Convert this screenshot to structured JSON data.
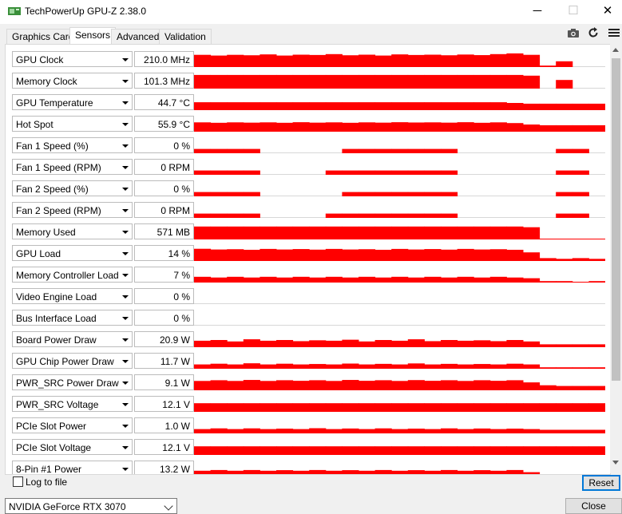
{
  "window": {
    "title": "TechPowerUp GPU-Z 2.38.0"
  },
  "tabs": [
    "Graphics Card",
    "Sensors",
    "Advanced",
    "Validation"
  ],
  "sensors": [
    {
      "name": "GPU Clock",
      "value": "210.0 MHz",
      "trace": [
        0.85,
        0.8,
        0.85,
        0.82,
        0.88,
        0.8,
        0.86,
        0.84,
        0.9,
        0.82,
        0.86,
        0.8,
        0.88,
        0.84,
        0.86,
        0.82,
        0.87,
        0.83,
        0.9,
        0.95,
        0.85,
        0.1,
        0.4,
        0.0,
        0.0
      ],
      "color": "#ff0000"
    },
    {
      "name": "Memory Clock",
      "value": "101.3 MHz",
      "trace": [
        0.95,
        0.95,
        0.95,
        0.95,
        0.95,
        0.95,
        0.95,
        0.95,
        0.95,
        0.95,
        0.95,
        0.95,
        0.95,
        0.95,
        0.95,
        0.95,
        0.95,
        0.95,
        0.95,
        0.95,
        0.9,
        0.0,
        0.6,
        0.0,
        0.0
      ],
      "color": "#ff0000"
    },
    {
      "name": "GPU Temperature",
      "value": "44.7 °C",
      "trace": [
        0.55,
        0.55,
        0.55,
        0.55,
        0.55,
        0.55,
        0.55,
        0.55,
        0.55,
        0.55,
        0.55,
        0.55,
        0.55,
        0.55,
        0.55,
        0.55,
        0.55,
        0.55,
        0.55,
        0.5,
        0.45,
        0.45,
        0.45,
        0.45,
        0.45
      ],
      "color": "#ff0000"
    },
    {
      "name": "Hot Spot",
      "value": "55.9 °C",
      "trace": [
        0.65,
        0.62,
        0.65,
        0.63,
        0.65,
        0.62,
        0.66,
        0.63,
        0.65,
        0.62,
        0.65,
        0.63,
        0.66,
        0.64,
        0.65,
        0.63,
        0.66,
        0.62,
        0.65,
        0.6,
        0.5,
        0.45,
        0.45,
        0.45,
        0.45
      ],
      "color": "#ff0000"
    },
    {
      "name": "Fan 1 Speed (%)",
      "value": "0 %",
      "trace": [
        0.3,
        0.3,
        0.3,
        0.3,
        0.0,
        0.0,
        0.0,
        0.0,
        0.0,
        0.3,
        0.3,
        0.3,
        0.3,
        0.3,
        0.3,
        0.3,
        0.0,
        0.0,
        0.0,
        0.0,
        0.0,
        0.0,
        0.3,
        0.3,
        0.0
      ],
      "color": "#ff0000"
    },
    {
      "name": "Fan 1 Speed (RPM)",
      "value": "0 RPM",
      "trace": [
        0.3,
        0.3,
        0.3,
        0.3,
        0.0,
        0.0,
        0.0,
        0.0,
        0.3,
        0.3,
        0.3,
        0.3,
        0.3,
        0.3,
        0.3,
        0.3,
        0.0,
        0.0,
        0.0,
        0.0,
        0.0,
        0.0,
        0.3,
        0.3,
        0.0
      ],
      "color": "#ff0000"
    },
    {
      "name": "Fan 2 Speed (%)",
      "value": "0 %",
      "trace": [
        0.3,
        0.3,
        0.3,
        0.3,
        0.0,
        0.0,
        0.0,
        0.0,
        0.0,
        0.3,
        0.3,
        0.3,
        0.3,
        0.3,
        0.3,
        0.3,
        0.0,
        0.0,
        0.0,
        0.0,
        0.0,
        0.0,
        0.3,
        0.3,
        0.0
      ],
      "color": "#ff0000"
    },
    {
      "name": "Fan 2 Speed (RPM)",
      "value": "0 RPM",
      "trace": [
        0.3,
        0.3,
        0.3,
        0.3,
        0.0,
        0.0,
        0.0,
        0.0,
        0.3,
        0.3,
        0.3,
        0.3,
        0.3,
        0.3,
        0.3,
        0.3,
        0.0,
        0.0,
        0.0,
        0.0,
        0.0,
        0.0,
        0.3,
        0.3,
        0.0
      ],
      "color": "#ff0000"
    },
    {
      "name": "Memory Used",
      "value": "571 MB",
      "trace": [
        0.9,
        0.9,
        0.9,
        0.9,
        0.9,
        0.9,
        0.9,
        0.9,
        0.9,
        0.9,
        0.9,
        0.9,
        0.9,
        0.9,
        0.9,
        0.9,
        0.9,
        0.9,
        0.9,
        0.9,
        0.85,
        0.05,
        0.05,
        0.05,
        0.05
      ],
      "color": "#ff0000"
    },
    {
      "name": "GPU Load",
      "value": "14 %",
      "trace": [
        0.85,
        0.8,
        0.82,
        0.78,
        0.84,
        0.8,
        0.83,
        0.79,
        0.84,
        0.8,
        0.82,
        0.78,
        0.84,
        0.8,
        0.83,
        0.79,
        0.84,
        0.8,
        0.82,
        0.78,
        0.6,
        0.2,
        0.15,
        0.2,
        0.15
      ],
      "color": "#ff0000"
    },
    {
      "name": "Memory Controller Load",
      "value": "7 %",
      "trace": [
        0.4,
        0.35,
        0.4,
        0.35,
        0.4,
        0.35,
        0.4,
        0.35,
        0.4,
        0.35,
        0.4,
        0.35,
        0.4,
        0.35,
        0.4,
        0.35,
        0.4,
        0.35,
        0.4,
        0.35,
        0.3,
        0.1,
        0.1,
        0.05,
        0.1
      ],
      "color": "#ff0000"
    },
    {
      "name": "Video Engine Load",
      "value": "0 %",
      "trace": [
        0,
        0,
        0,
        0,
        0,
        0,
        0,
        0,
        0,
        0,
        0,
        0,
        0,
        0,
        0,
        0,
        0,
        0,
        0,
        0,
        0,
        0,
        0,
        0,
        0
      ],
      "color": "#ff0000"
    },
    {
      "name": "Bus Interface Load",
      "value": "0 %",
      "trace": [
        0,
        0,
        0,
        0,
        0,
        0,
        0,
        0,
        0,
        0,
        0,
        0,
        0,
        0,
        0,
        0,
        0,
        0,
        0,
        0,
        0,
        0,
        0,
        0,
        0
      ],
      "color": "#ff0000"
    },
    {
      "name": "Board Power Draw",
      "value": "20.9 W",
      "trace": [
        0.45,
        0.5,
        0.4,
        0.55,
        0.45,
        0.5,
        0.42,
        0.48,
        0.45,
        0.52,
        0.4,
        0.5,
        0.45,
        0.55,
        0.42,
        0.5,
        0.45,
        0.48,
        0.42,
        0.5,
        0.4,
        0.2,
        0.2,
        0.2,
        0.2
      ],
      "color": "#ff0000"
    },
    {
      "name": "GPU Chip Power Draw",
      "value": "11.7 W",
      "trace": [
        0.3,
        0.35,
        0.3,
        0.38,
        0.3,
        0.35,
        0.3,
        0.33,
        0.3,
        0.36,
        0.3,
        0.34,
        0.3,
        0.37,
        0.3,
        0.34,
        0.3,
        0.33,
        0.3,
        0.35,
        0.3,
        0.1,
        0.1,
        0.1,
        0.1
      ],
      "color": "#ff0000"
    },
    {
      "name": "PWR_SRC Power Draw",
      "value": "9.1 W",
      "trace": [
        0.65,
        0.7,
        0.65,
        0.72,
        0.65,
        0.7,
        0.66,
        0.7,
        0.65,
        0.72,
        0.66,
        0.7,
        0.65,
        0.71,
        0.66,
        0.7,
        0.65,
        0.7,
        0.66,
        0.7,
        0.55,
        0.35,
        0.3,
        0.3,
        0.3
      ],
      "color": "#ff0000"
    },
    {
      "name": "PWR_SRC Voltage",
      "value": "12.1 V",
      "trace": [
        0.6,
        0.6,
        0.6,
        0.6,
        0.6,
        0.6,
        0.6,
        0.6,
        0.6,
        0.6,
        0.6,
        0.6,
        0.6,
        0.6,
        0.6,
        0.6,
        0.6,
        0.6,
        0.6,
        0.6,
        0.6,
        0.6,
        0.6,
        0.6,
        0.6
      ],
      "color": "#ff0000"
    },
    {
      "name": "PCIe Slot Power",
      "value": "1.0 W",
      "trace": [
        0.3,
        0.35,
        0.3,
        0.35,
        0.3,
        0.33,
        0.3,
        0.36,
        0.3,
        0.34,
        0.3,
        0.35,
        0.3,
        0.33,
        0.3,
        0.35,
        0.3,
        0.34,
        0.3,
        0.33,
        0.3,
        0.25,
        0.25,
        0.25,
        0.25
      ],
      "color": "#ff0000"
    },
    {
      "name": "PCIe Slot Voltage",
      "value": "12.1 V",
      "trace": [
        0.6,
        0.6,
        0.6,
        0.6,
        0.6,
        0.6,
        0.6,
        0.6,
        0.6,
        0.6,
        0.6,
        0.6,
        0.6,
        0.6,
        0.6,
        0.6,
        0.6,
        0.6,
        0.6,
        0.6,
        0.6,
        0.6,
        0.6,
        0.6,
        0.6
      ],
      "color": "#ff0000"
    },
    {
      "name": "8-Pin #1 Power",
      "value": "13.2 W",
      "trace": [
        0.4,
        0.45,
        0.4,
        0.45,
        0.4,
        0.44,
        0.4,
        0.45,
        0.4,
        0.44,
        0.4,
        0.45,
        0.4,
        0.44,
        0.4,
        0.45,
        0.4,
        0.44,
        0.4,
        0.45,
        0.3,
        0.15,
        0.15,
        0.15,
        0.15
      ],
      "color": "#ff0000"
    }
  ],
  "footer": {
    "log_label": "Log to file",
    "reset_label": "Reset",
    "gpu_selected": "NVIDIA GeForce RTX 3070",
    "close_label": "Close"
  },
  "icons": {
    "app": "gpu-card-icon",
    "camera": "camera-icon",
    "refresh": "refresh-icon",
    "menu": "hamburger-menu-icon"
  }
}
